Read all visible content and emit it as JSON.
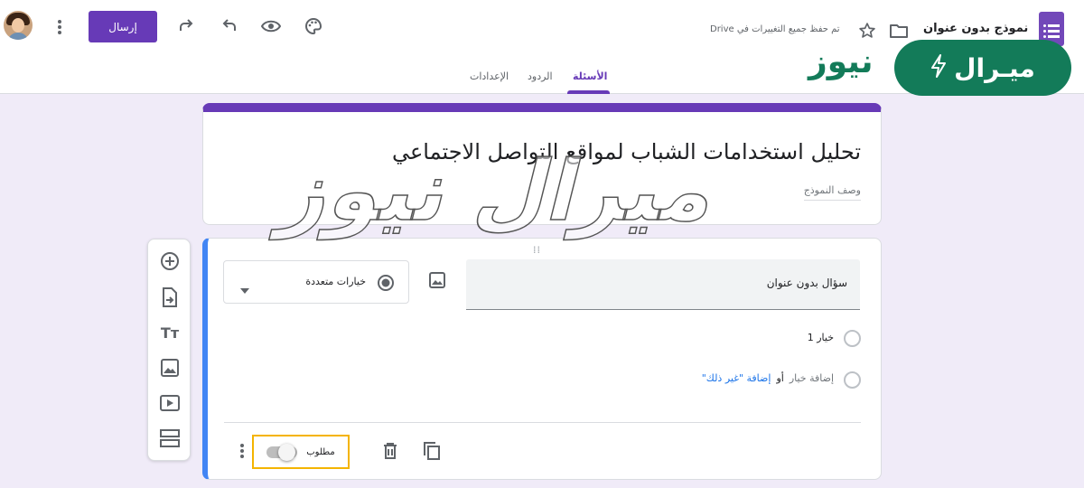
{
  "topbar": {
    "send_label": "إرسال",
    "saved_status": "تم حفظ جميع التغييرات في Drive",
    "form_name": "نموذج بدون عنوان",
    "icons": [
      "more-vert-icon",
      "redo-icon",
      "undo-icon",
      "preview-icon",
      "palette-icon",
      "star-icon",
      "folder-icon",
      "forms-logo-icon"
    ]
  },
  "tabs": [
    {
      "label": "الأسئلة",
      "active": true
    },
    {
      "label": "الردود",
      "active": false
    },
    {
      "label": "الإعدادات",
      "active": false
    }
  ],
  "form": {
    "title": "تحليل استخدامات الشباب لمواقع التواصل الاجتماعي",
    "description_placeholder": "وصف النموذج"
  },
  "question": {
    "title": "سؤال بدون عنوان",
    "type": "خيارات متعددة",
    "option_1": "خيار 1",
    "add_option": "إضافة خيار",
    "or": "أو",
    "add_other": "إضافة \"غير ذلك\"",
    "required_label": "مطلوب",
    "required_on": false
  },
  "toolbox": [
    "add-question-icon",
    "import-questions-icon",
    "title-text-icon",
    "add-image-icon",
    "add-video-icon",
    "add-section-icon"
  ],
  "branding": {
    "badge_text": "ميـرال",
    "second_text": "نيوز",
    "watermark": "ميرال نيوز"
  },
  "colors": {
    "accent": "#673ab7",
    "blue": "#4285f4",
    "brand": "#137b59",
    "required_outline": "#f4b400",
    "background": "#f0ebf8"
  }
}
